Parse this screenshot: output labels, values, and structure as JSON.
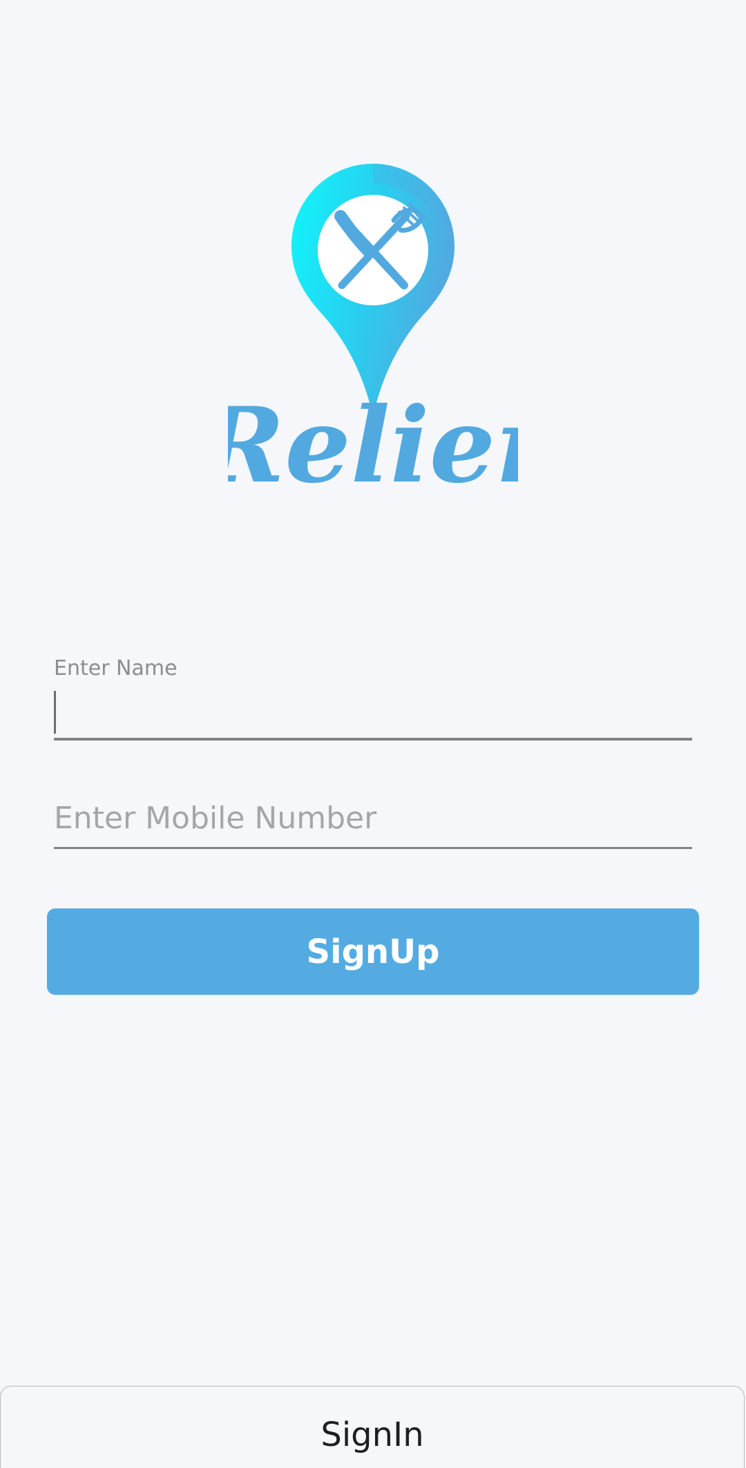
{
  "brand": {
    "name": "Relier",
    "primary_color": "#54abe2",
    "accent_cyan": "#0ff6fb",
    "logo_icon": "location-pin-fork-knife-icon"
  },
  "form": {
    "name_label": "Enter Name",
    "name_value": "",
    "mobile_placeholder": "Enter Mobile Number",
    "mobile_value": ""
  },
  "actions": {
    "signup_label": "SignUp",
    "signin_label": "SignIn"
  }
}
